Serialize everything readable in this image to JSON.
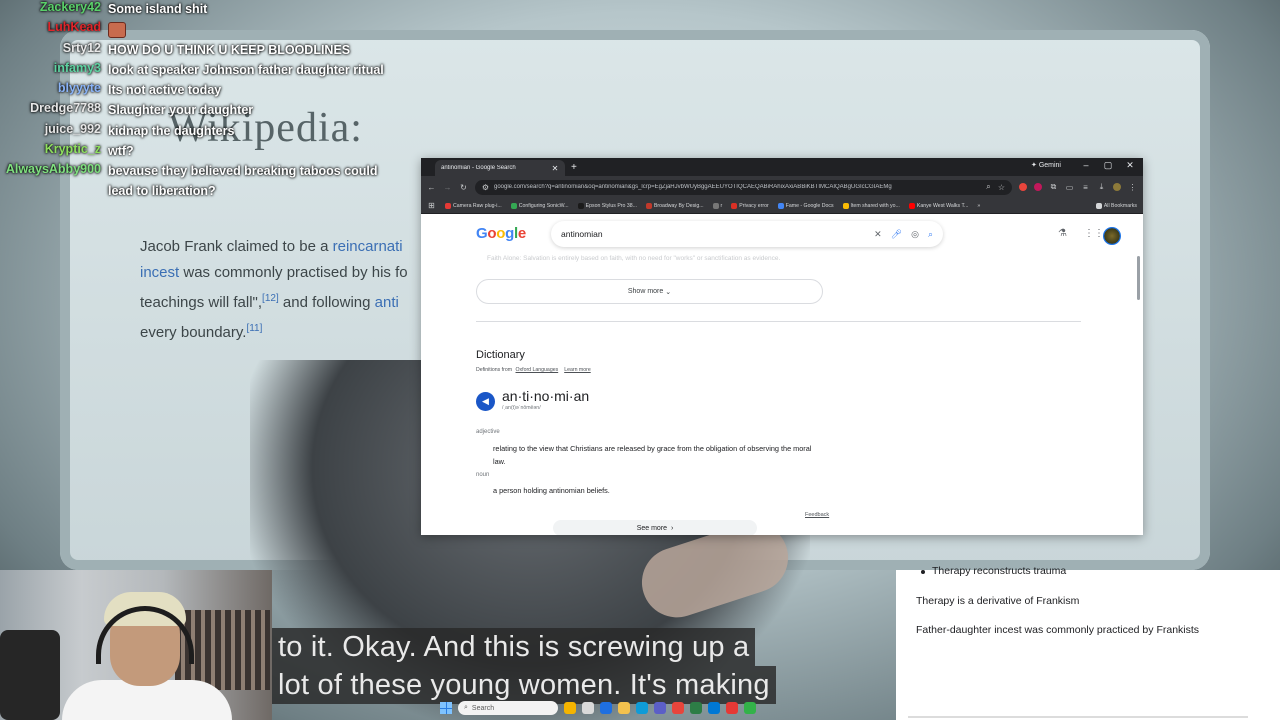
{
  "background": {
    "wiki_title": "Wikipedia:",
    "wiki_lines": [
      {
        "pre": "Jacob Frank claimed to be a ",
        "link": "reincarnati",
        "post": "",
        "sup": ""
      },
      {
        "pre": "",
        "link": "incest",
        "post": " was commonly practised by his fo",
        "sup": ""
      },
      {
        "pre": "teachings will fall\",",
        "link": "",
        "post": " and following ",
        "sup": "[12]",
        "link2": "anti"
      },
      {
        "pre": "every boundary.",
        "link": "",
        "post": "",
        "sup": "[11]"
      }
    ]
  },
  "chat": [
    {
      "user": "Zackery42",
      "color": "#5ad06a",
      "msg": "Some island shit"
    },
    {
      "user": "LuhKead",
      "color": "#e0252a",
      "msg": "",
      "emote": "face-emote"
    },
    {
      "user": "Srty12",
      "color": "#e8e8e8",
      "msg": "HOW DO U THINK U KEEP BLOODLINES"
    },
    {
      "user": "infamy3",
      "color": "#5ed3a2",
      "msg": "look at speaker Johnson father daughter ritual"
    },
    {
      "user": "blyyyte",
      "color": "#8ab4f8",
      "msg": "Its not active today"
    },
    {
      "user": "Dredge7788",
      "color": "#e8e8e8",
      "msg": "Slaughter your daughter"
    },
    {
      "user": "juice_992",
      "color": "#e8e8e8",
      "msg": "kidnap the daughters"
    },
    {
      "user": "Kryptic_z",
      "color": "#8ee05e",
      "msg": "wtf?"
    },
    {
      "user": "AlwaysAbby900",
      "color": "#7fe07f",
      "msg": "bevause they believed breaking taboos could lead to liberation?"
    }
  ],
  "browser": {
    "tab_title": "antinomian - Google Search",
    "gemini_label": "Gemini",
    "url": "google.com/search?q=antinomian&oq=antinomian&gs_lcrp=EgZjaHJvbWUyBggAEEUYOTIQCAEQABiRAhixAxiABBiKBTIMCAIQABgUGIcCGIAEMg",
    "bookmarks": [
      {
        "label": "Camera Raw plug-i...",
        "color": "#e53935"
      },
      {
        "label": "Configuring SonicW...",
        "color": "#34a853"
      },
      {
        "label": "Epson Stylus Pro 38...",
        "color": "#1a1a1a"
      },
      {
        "label": "Broadway By Desig...",
        "color": "#c0392b"
      },
      {
        "label": "r",
        "color": "#777777"
      },
      {
        "label": "Privacy error",
        "color": "#d93025"
      },
      {
        "label": "Fame - Google Docs",
        "color": "#4285f4"
      },
      {
        "label": "Item shared with yo...",
        "color": "#fbbc05"
      },
      {
        "label": "Kanye West Walks T...",
        "color": "#ff0000"
      }
    ],
    "all_bookmarks": "All Bookmarks"
  },
  "google": {
    "logo": "Google",
    "query": "antinomian",
    "faded_text": "Faith Alone: Salvation is entirely based on faith, with no need for \"works\" or sanctification as evidence.",
    "show_more": "Show more",
    "dictionary_heading": "Dictionary",
    "definitions_from": "Definitions from",
    "oxford": "Oxford Languages",
    "learn_more": "Learn more",
    "word": "an·ti·no·mi·an",
    "phonetic": "/ˌan(t)əˈnōmēən/",
    "adjective_label": "adjective",
    "adjective_def": "relating to the view that Christians are released by grace from the obligation of observing the moral law.",
    "noun_label": "noun",
    "noun_def": "a person holding antinomian beliefs.",
    "feedback": "Feedback",
    "see_more": "See more"
  },
  "doc": {
    "bullet": "Therapy reconstructs trauma",
    "line1": "Therapy is a derivative of Frankism",
    "line2": "Father-daughter incest was commonly practiced by Frankists"
  },
  "caption": {
    "line1": "to it. Okay. And this is screwing up a",
    "line2": "lot of these young women. It's making"
  },
  "taskbar": {
    "search_placeholder": "Search",
    "app_colors": [
      "#f5b400",
      "#d9d9d9",
      "#1f6fe0",
      "#f2c14e",
      "#0f9bd7",
      "#5b5fc7",
      "#e8453c",
      "#2d7d46",
      "#0078d4",
      "#e53935",
      "#33b249"
    ]
  }
}
